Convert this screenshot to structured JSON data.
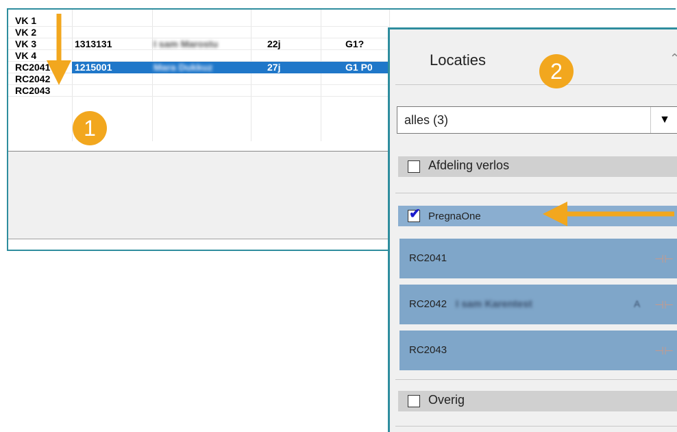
{
  "grid": {
    "rows": [
      {
        "location": "VK 1",
        "id": "",
        "name": "",
        "age": "",
        "g": ""
      },
      {
        "location": "VK 2",
        "id": "",
        "name": "",
        "age": "",
        "g": ""
      },
      {
        "location": "VK 3",
        "id": "1313131",
        "name": "I sam Marostu",
        "age": "22j",
        "g": "G1?"
      },
      {
        "location": "VK 4",
        "id": "",
        "name": "",
        "age": "",
        "g": ""
      },
      {
        "location": "RC2041",
        "id": "1215001",
        "name": "Mara Dukkuz",
        "age": "27j",
        "g": "G1 P0"
      },
      {
        "location": "RC2042",
        "id": "",
        "name": "",
        "age": "",
        "g": ""
      },
      {
        "location": "RC2043",
        "id": "",
        "name": "",
        "age": "",
        "g": ""
      }
    ],
    "selected_row_index": 4
  },
  "panel": {
    "title": "Locaties",
    "collapse_icon": "double-chevron-up-icon",
    "filter": {
      "selected": "alles (3)",
      "caret": "▼"
    },
    "groups": [
      {
        "label": "Afdeling verlos",
        "checked": false
      },
      {
        "label": "PregnaOne",
        "checked": true
      },
      {
        "label": "Overig",
        "checked": false
      }
    ],
    "locations": [
      {
        "label": "RC2041",
        "occupant": "",
        "flag": "",
        "icon": "pin-icon"
      },
      {
        "label": "RC2042",
        "occupant": "I sam Karentest",
        "flag": "A",
        "icon": "pin-icon"
      },
      {
        "label": "RC2043",
        "occupant": "",
        "flag": "",
        "icon": "pin-icon"
      }
    ]
  },
  "annotations": {
    "badge_1": "1",
    "badge_2": "2",
    "accent_color": "#f2a71e",
    "selection_color": "#1f77c9",
    "frame_color": "#2e8d9e"
  }
}
